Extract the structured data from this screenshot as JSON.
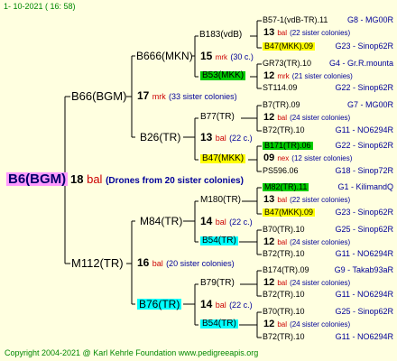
{
  "date": "1- 10-2021 ( 16: 58)",
  "footer": "Copyright 2004-2021 @ Karl Kehrle Foundation   www.pedigreeapis.org",
  "root": {
    "label": "B6(BGM)",
    "num": "18",
    "mid": "bal",
    "sis": "(Drones from 20 sister colonies)"
  },
  "gen1": [
    {
      "label": "B66(BGM)",
      "num": "17",
      "mid": "mrk",
      "sis": "(33 sister colonies)"
    },
    {
      "label": "M112(TR)",
      "num": "16",
      "mid": "bal",
      "sis": "(20 sister colonies)"
    }
  ],
  "gen2": [
    {
      "label": "B666(MKN)",
      "num": "15",
      "mid": "mrk",
      "sis": "(30 c.)"
    },
    {
      "label": "B26(TR)",
      "num": "13",
      "mid": "bal",
      "sis": "(22 c.)"
    },
    {
      "label": "M84(TR)",
      "num": "14",
      "mid": "bal",
      "sis": "(22 c.)"
    },
    {
      "label": "B76(TR)",
      "num": "14",
      "mid": "bal",
      "sis": "(22 c.)"
    }
  ],
  "gen3": [
    "B183(vdB)",
    "B53(MKK)",
    "B77(TR)",
    "B47(MKK)",
    "M180(TR)",
    "B54(TR)",
    "B79(TR)",
    "B54(TR)"
  ],
  "gen4": [
    {
      "label": "B57-1(vdB-TR).11",
      "info": "G8 - MG00R"
    },
    {
      "num": "13",
      "mid": "bal",
      "sis": "(22 sister colonies)"
    },
    {
      "label": "B47(MKK).09",
      "info": "G23 - Sinop62R"
    },
    {
      "label": "GR73(TR).10",
      "info": "G4 - Gr.R.mounta"
    },
    {
      "num": "12",
      "mid": "mrk",
      "sis": "(21 sister colonies)"
    },
    {
      "label": "ST114.09",
      "info": "G22 - Sinop62R"
    },
    {
      "label": "B7(TR).09",
      "info": "G7 - MG00R"
    },
    {
      "num": "12",
      "mid": "bal",
      "sis": "(24 sister colonies)"
    },
    {
      "label": "B72(TR).10",
      "info": "G11 - NO6294R"
    },
    {
      "label": "B171(TR).06",
      "info": "G22 - Sinop62R"
    },
    {
      "num": "09",
      "mid": "nex",
      "sis": "(12 sister colonies)"
    },
    {
      "label": "PS596.06",
      "info": "G18 - Sinop72R"
    },
    {
      "label": "M82(TR).11",
      "info": "G1 - KilimandQ"
    },
    {
      "num": "13",
      "mid": "bal",
      "sis": "(22 sister colonies)"
    },
    {
      "label": "B47(MKK).09",
      "info": "G23 - Sinop62R"
    },
    {
      "label": "B70(TR).10",
      "info": "G25 - Sinop62R"
    },
    {
      "num": "12",
      "mid": "bal",
      "sis": "(24 sister colonies)"
    },
    {
      "label": "B72(TR).10",
      "info": "G11 - NO6294R"
    },
    {
      "label": "B174(TR).09",
      "info": "G9 - Takab93aR"
    },
    {
      "num": "12",
      "mid": "bal",
      "sis": "(24 sister colonies)"
    },
    {
      "label": "B72(TR).10",
      "info": "G11 - NO6294R"
    },
    {
      "label": "B70(TR).10",
      "info": "G25 - Sinop62R"
    },
    {
      "num": "12",
      "mid": "bal",
      "sis": "(24 sister colonies)"
    },
    {
      "label": "B72(TR).10",
      "info": "G11 - NO6294R"
    }
  ],
  "colors": {
    "background": "#ffffe0",
    "line": "#000000",
    "yellow": "#ffff00",
    "green": "#00cc00",
    "cyan": "#00ffff",
    "pink": "#ff99ff",
    "red": "#cc0000",
    "blue": "#000099"
  }
}
